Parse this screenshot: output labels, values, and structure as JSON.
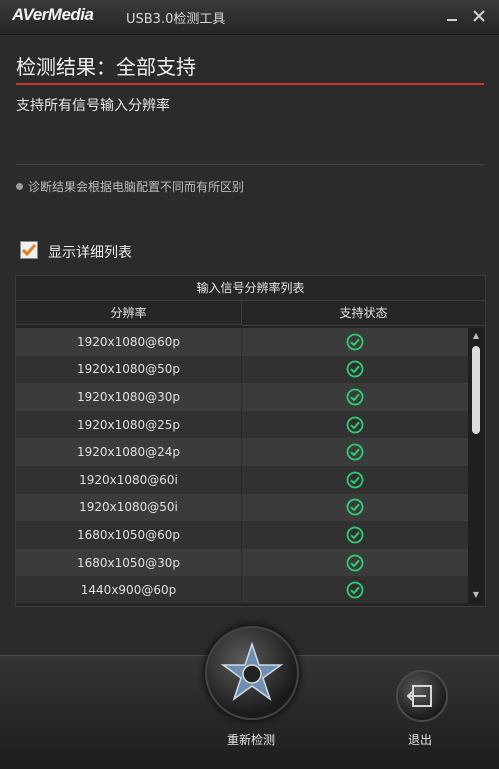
{
  "titlebar": {
    "logo": "AVerMedia",
    "title": "USB3.0检测工具",
    "minimize_icon": "minimize-icon",
    "close_icon": "close-icon"
  },
  "result": {
    "title": "检测结果：全部支持",
    "subtitle": "支持所有信号输入分辨率",
    "note": "诊断结果会根据电脑配置不同而有所区别"
  },
  "detail_toggle": {
    "label": "显示详细列表",
    "checked": true
  },
  "table": {
    "caption": "输入信号分辨率列表",
    "headers": [
      "分辨率",
      "支持状态"
    ],
    "rows": [
      {
        "resolution": "1920x1080@60p",
        "status": "supported"
      },
      {
        "resolution": "1920x1080@50p",
        "status": "supported"
      },
      {
        "resolution": "1920x1080@30p",
        "status": "supported"
      },
      {
        "resolution": "1920x1080@25p",
        "status": "supported"
      },
      {
        "resolution": "1920x1080@24p",
        "status": "supported"
      },
      {
        "resolution": "1920x1080@60i",
        "status": "supported"
      },
      {
        "resolution": "1920x1080@50i",
        "status": "supported"
      },
      {
        "resolution": "1680x1050@60p",
        "status": "supported"
      },
      {
        "resolution": "1680x1050@30p",
        "status": "supported"
      },
      {
        "resolution": "1440x900@60p",
        "status": "supported"
      }
    ]
  },
  "footer": {
    "rescan_label": "重新检测",
    "exit_label": "退出"
  },
  "colors": {
    "accent_red": "#c0392b",
    "check_green": "#2ecc71",
    "checkbox_orange": "#e67e22"
  }
}
